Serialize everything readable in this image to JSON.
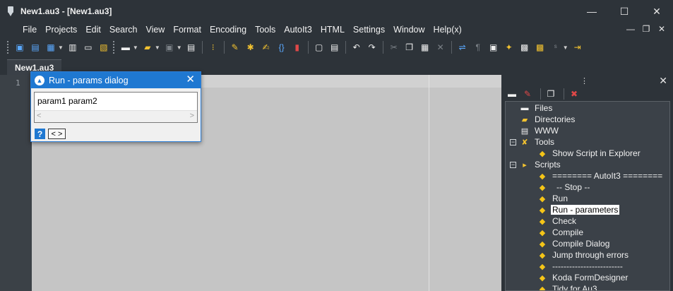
{
  "window": {
    "title": "New1.au3 - [New1.au3]",
    "minimize_glyph": "—",
    "maximize_glyph": "☐",
    "close_glyph": "✕"
  },
  "menu": [
    "File",
    "Projects",
    "Edit",
    "Search",
    "View",
    "Format",
    "Encoding",
    "Tools",
    "AutoIt3",
    "HTML",
    "Settings",
    "Window",
    "Help(x)"
  ],
  "mdi": {
    "minimize_glyph": "—",
    "restore_glyph": "❐",
    "close_glyph": "✕"
  },
  "tabs": [
    {
      "label": "New1.au3",
      "active": true
    }
  ],
  "editor": {
    "line_numbers": [
      "1"
    ]
  },
  "dialog": {
    "title": "Run - params dialog",
    "close_glyph": "✕",
    "input_value": "param1 param2",
    "help_label": "?",
    "toggle_label": "< >",
    "scroll_left": "<",
    "scroll_right": ">"
  },
  "panel": {
    "close_glyph": "✕",
    "grip_glyph": "⋮",
    "tree": [
      {
        "label": "Files",
        "icon": "file-icon",
        "expander": "",
        "indent": 0
      },
      {
        "label": "Directories",
        "icon": "folder-icon",
        "expander": "",
        "indent": 0
      },
      {
        "label": "WWW",
        "icon": "www-icon",
        "expander": "",
        "indent": 0
      },
      {
        "label": "Tools",
        "icon": "tools-icon",
        "expander": "−",
        "indent": 0
      },
      {
        "label": "Show Script in Explorer",
        "icon": "diamond-icon",
        "expander": "",
        "indent": 1
      },
      {
        "label": "Scripts",
        "icon": "scripts-icon",
        "expander": "−",
        "indent": 0
      },
      {
        "label": "======== AutoIt3 ========",
        "icon": "diamond-icon",
        "expander": "",
        "indent": 1
      },
      {
        "label": "-- Stop --",
        "icon": "diamond-icon",
        "expander": "",
        "indent": 1,
        "pad": true
      },
      {
        "label": "Run",
        "icon": "diamond-icon",
        "expander": "",
        "indent": 1
      },
      {
        "label": "Run - parameters",
        "icon": "diamond-icon",
        "expander": "",
        "indent": 1,
        "selected": true
      },
      {
        "label": "Check",
        "icon": "diamond-icon",
        "expander": "",
        "indent": 1
      },
      {
        "label": "Compile",
        "icon": "diamond-icon",
        "expander": "",
        "indent": 1
      },
      {
        "label": "Compile Dialog",
        "icon": "diamond-icon",
        "expander": "",
        "indent": 1
      },
      {
        "label": "Jump through errors",
        "icon": "diamond-icon",
        "expander": "",
        "indent": 1
      },
      {
        "label": "-------------------------",
        "icon": "diamond-icon",
        "expander": "",
        "indent": 1
      },
      {
        "label": "Koda FormDesigner",
        "icon": "diamond-icon",
        "expander": "",
        "indent": 1
      },
      {
        "label": "Tidy for Au3",
        "icon": "diamond-icon",
        "expander": "",
        "indent": 1
      }
    ]
  },
  "colors": {
    "background": "#2d3339",
    "editor_bg": "#c5c5c5",
    "accent": "#1f78d1",
    "tree_bg": "#3b4148",
    "diamond": "#f5c518"
  }
}
